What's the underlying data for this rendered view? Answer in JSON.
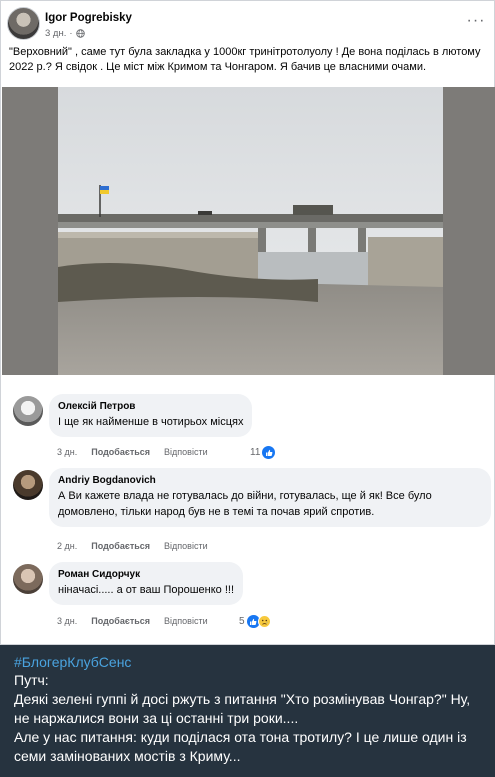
{
  "post": {
    "author": "Igor Pogrebisky",
    "time": "3 дн.",
    "privacy_icon": "globe-icon",
    "more_icon": "more-horizontal-icon",
    "more_label": "···",
    "text": "\"Верховний\" , саме тут була закладка у 1000кг тринітротолуолу ! Де вона поділась  в лютому 2022 р.? Я свідок . Це міст між Кримом та Чонгаром. Я бачив це власними очами."
  },
  "comments": [
    {
      "name": "Олексій Петров",
      "text": "І ще як найменше в чотирьох місцях",
      "time": "3 дн.",
      "like": "Подобається",
      "reply": "Відповісти",
      "reactions_count": "11",
      "reactions": [
        "like"
      ]
    },
    {
      "name": "Andriy Bogdanovich",
      "text": "А Ви кажете влада не готувалась до війни, готувалась, ще й як! Все було домовлено, тільки народ був не в темі та почав ярий спротив.",
      "time": "2 дн.",
      "like": "Подобається",
      "reply": "Відповісти"
    },
    {
      "name": "Роман Сидорчук",
      "text": "ніначасі..... а от ваш Порошенко !!!",
      "time": "3 дн.",
      "like": "Подобається",
      "reply": "Відповісти",
      "reactions_count": "5",
      "reactions": [
        "like",
        "sad"
      ]
    }
  ],
  "footer": {
    "hashtag": "#БлогерКлубСенс",
    "line1": "Путч:",
    "line2": "Деякі зелені гуппі й досі ржуть з питання \"Хто розмінував Чонгар?\" Ну, не наржалися вони за ці останні три роки....",
    "line3": "Але у нас питання: куди поділася ота тона тротилу? І це лише один із семи замінованих мостів з Криму..."
  },
  "colors": {
    "accent": "#1877f2",
    "footer_bg": "#26333f",
    "hashtag": "#4aa3df",
    "bubble": "#f0f2f5",
    "meta_text": "#65676b"
  }
}
